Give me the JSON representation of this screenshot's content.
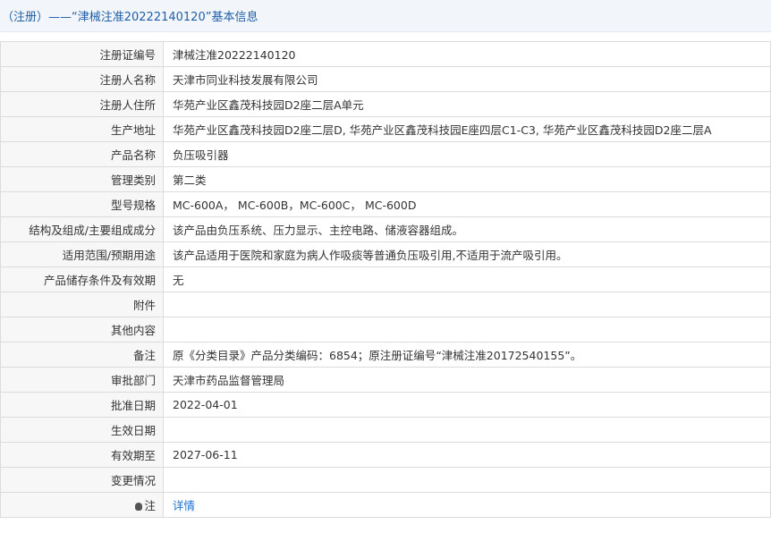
{
  "header": {
    "breadcrumb_text": "（注册）——“津械注准20222140120”基本信息"
  },
  "rows": [
    {
      "label": "注册证编号",
      "value": "津械注准20222140120"
    },
    {
      "label": "注册人名称",
      "value": "天津市同业科技发展有限公司"
    },
    {
      "label": "注册人住所",
      "value": "华苑产业区鑫茂科技园D2座二层A单元"
    },
    {
      "label": "生产地址",
      "value": "华苑产业区鑫茂科技园D2座二层D, 华苑产业区鑫茂科技园E座四层C1-C3, 华苑产业区鑫茂科技园D2座二层A"
    },
    {
      "label": "产品名称",
      "value": "负压吸引器"
    },
    {
      "label": "管理类别",
      "value": "第二类"
    },
    {
      "label": "型号规格",
      "value": "MC-600A， MC-600B，MC-600C， MC-600D"
    },
    {
      "label": "结构及组成/主要组成成分",
      "value": "该产品由负压系统、压力显示、主控电路、储液容器组成。"
    },
    {
      "label": "适用范围/预期用途",
      "value": "该产品适用于医院和家庭为病人作吸痰等普通负压吸引用,不适用于流产吸引用。"
    },
    {
      "label": "产品储存条件及有效期",
      "value": "无"
    },
    {
      "label": "附件",
      "value": ""
    },
    {
      "label": "其他内容",
      "value": ""
    },
    {
      "label": "备注",
      "value": "原《分类目录》产品分类编码：6854；原注册证编号“津械注准20172540155”。"
    },
    {
      "label": "审批部门",
      "value": "天津市药品监督管理局"
    },
    {
      "label": "批准日期",
      "value": "2022-04-01"
    },
    {
      "label": "生效日期",
      "value": ""
    },
    {
      "label": "有效期至",
      "value": "2027-06-11"
    },
    {
      "label": "变更情况",
      "value": ""
    }
  ],
  "note": {
    "label": "注",
    "link_text": "详情"
  }
}
